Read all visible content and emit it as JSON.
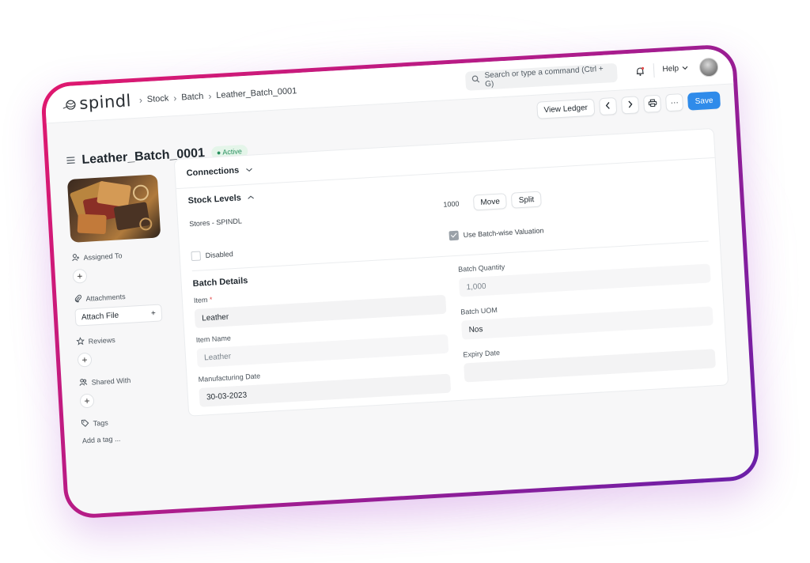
{
  "brand": {
    "name": "spindl"
  },
  "breadcrumb": [
    "Stock",
    "Batch",
    "Leather_Batch_0001"
  ],
  "search": {
    "placeholder": "Search or type a command (Ctrl + G)"
  },
  "header": {
    "help_label": "Help"
  },
  "toolbar": {
    "view_ledger_label": "View Ledger",
    "prev_icon": "chevron-left-icon",
    "next_icon": "chevron-right-icon",
    "print_icon": "printer-icon",
    "more_label": "···",
    "save_label": "Save"
  },
  "doc": {
    "title": "Leather_Batch_0001",
    "status": "Active"
  },
  "sidebar": {
    "assigned_to": "Assigned To",
    "attachments": "Attachments",
    "attach_file": "Attach File",
    "reviews": "Reviews",
    "shared_with": "Shared With",
    "tags": "Tags",
    "add_tag": "Add a tag ..."
  },
  "connections": {
    "label": "Connections"
  },
  "stock_levels": {
    "label": "Stock Levels",
    "rows": [
      {
        "warehouse": "Stores - SPINDL",
        "qty": "1000",
        "move": "Move",
        "split": "Split"
      }
    ]
  },
  "checks": {
    "disabled": {
      "label": "Disabled",
      "checked": false
    },
    "batch_valuation": {
      "label": "Use Batch-wise Valuation",
      "checked": true
    }
  },
  "batch_details": {
    "title": "Batch Details",
    "item": {
      "label": "Item",
      "required_mark": "*",
      "value": "Leather"
    },
    "item_name": {
      "label": "Item Name",
      "value": "Leather"
    },
    "manufacturing_date": {
      "label": "Manufacturing Date",
      "value": "30-03-2023"
    },
    "batch_quantity": {
      "label": "Batch Quantity",
      "value": "1,000"
    },
    "batch_uom": {
      "label": "Batch UOM",
      "value": "Nos"
    },
    "expiry_date": {
      "label": "Expiry Date",
      "value": ""
    }
  }
}
